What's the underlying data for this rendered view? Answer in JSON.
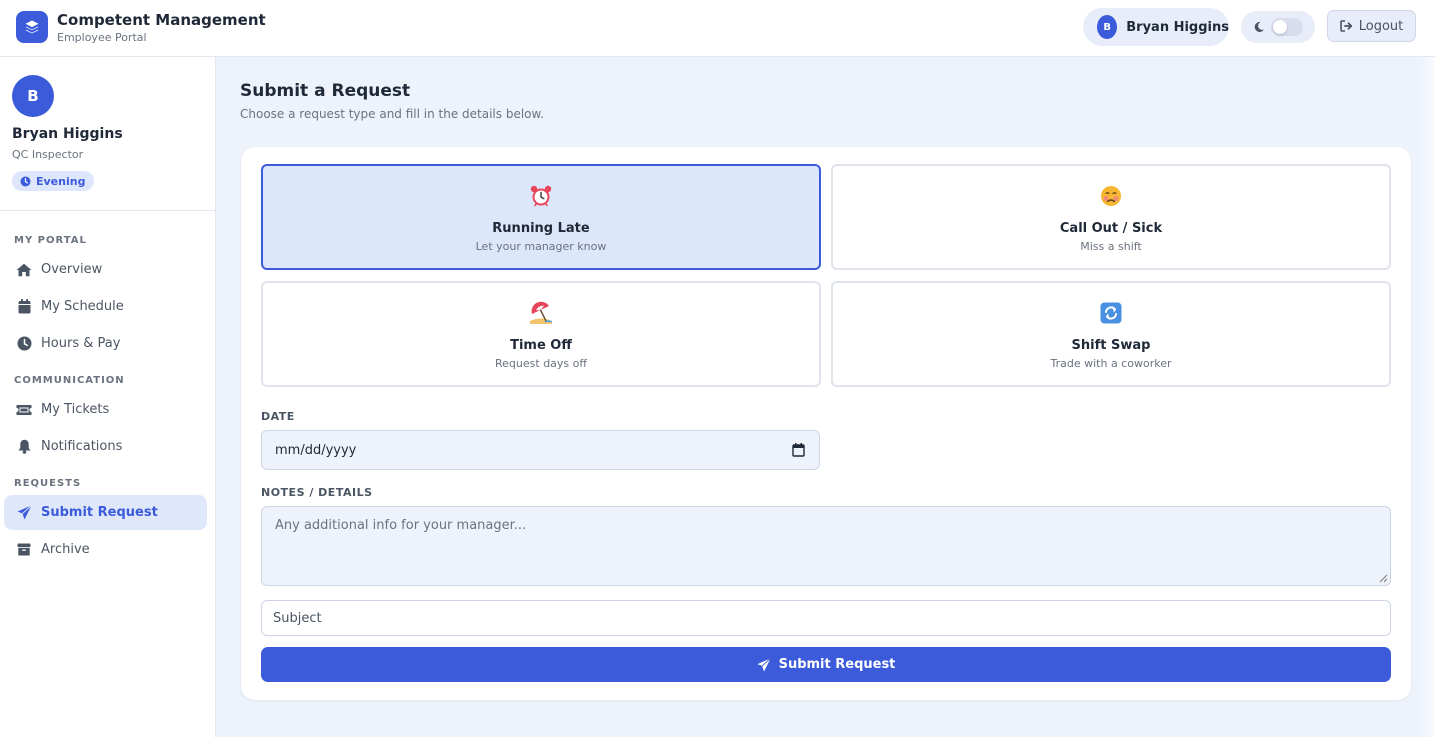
{
  "app": {
    "title": "Competent Management",
    "subtitle": "Employee Portal"
  },
  "topbar": {
    "user_initial": "B",
    "user_name": "Bryan Higgins",
    "logout_label": "Logout"
  },
  "profile": {
    "initial": "B",
    "name": "Bryan Higgins",
    "role": "QC Inspector",
    "shift_badge": "Evening"
  },
  "sidebar": {
    "sections": [
      {
        "label": "MY PORTAL"
      },
      {
        "label": "COMMUNICATION"
      },
      {
        "label": "REQUESTS"
      }
    ],
    "items": [
      {
        "label": "Overview",
        "icon": "home-icon"
      },
      {
        "label": "My Schedule",
        "icon": "calendar-icon"
      },
      {
        "label": "Hours & Pay",
        "icon": "clock-icon"
      },
      {
        "label": "My Tickets",
        "icon": "ticket-icon"
      },
      {
        "label": "Notifications",
        "icon": "bell-icon"
      },
      {
        "label": "Submit Request",
        "icon": "paper-plane-icon",
        "active": true
      },
      {
        "label": "Archive",
        "icon": "archive-icon"
      }
    ]
  },
  "page": {
    "title": "Submit a Request",
    "subtitle": "Choose a request type and fill in the details below."
  },
  "request_types": [
    {
      "title": "Running Late",
      "subtitle": "Let your manager know",
      "icon": "alarm-clock-icon",
      "selected": true
    },
    {
      "title": "Call Out / Sick",
      "subtitle": "Miss a shift",
      "icon": "sick-face-icon",
      "selected": false
    },
    {
      "title": "Time Off",
      "subtitle": "Request days off",
      "icon": "beach-umbrella-icon",
      "selected": false
    },
    {
      "title": "Shift Swap",
      "subtitle": "Trade with a coworker",
      "icon": "swap-arrows-icon",
      "selected": false
    }
  ],
  "form": {
    "date_label": "DATE",
    "date_placeholder": "mm/dd/yyyy",
    "notes_label": "NOTES / DETAILS",
    "notes_placeholder": "Any additional info for your manager...",
    "subject_placeholder": "Subject",
    "submit_label": "Submit Request"
  },
  "colors": {
    "accent": "#3b5bdb",
    "accent_light": "#dde7fb",
    "page_bg": "#eef2fb"
  }
}
